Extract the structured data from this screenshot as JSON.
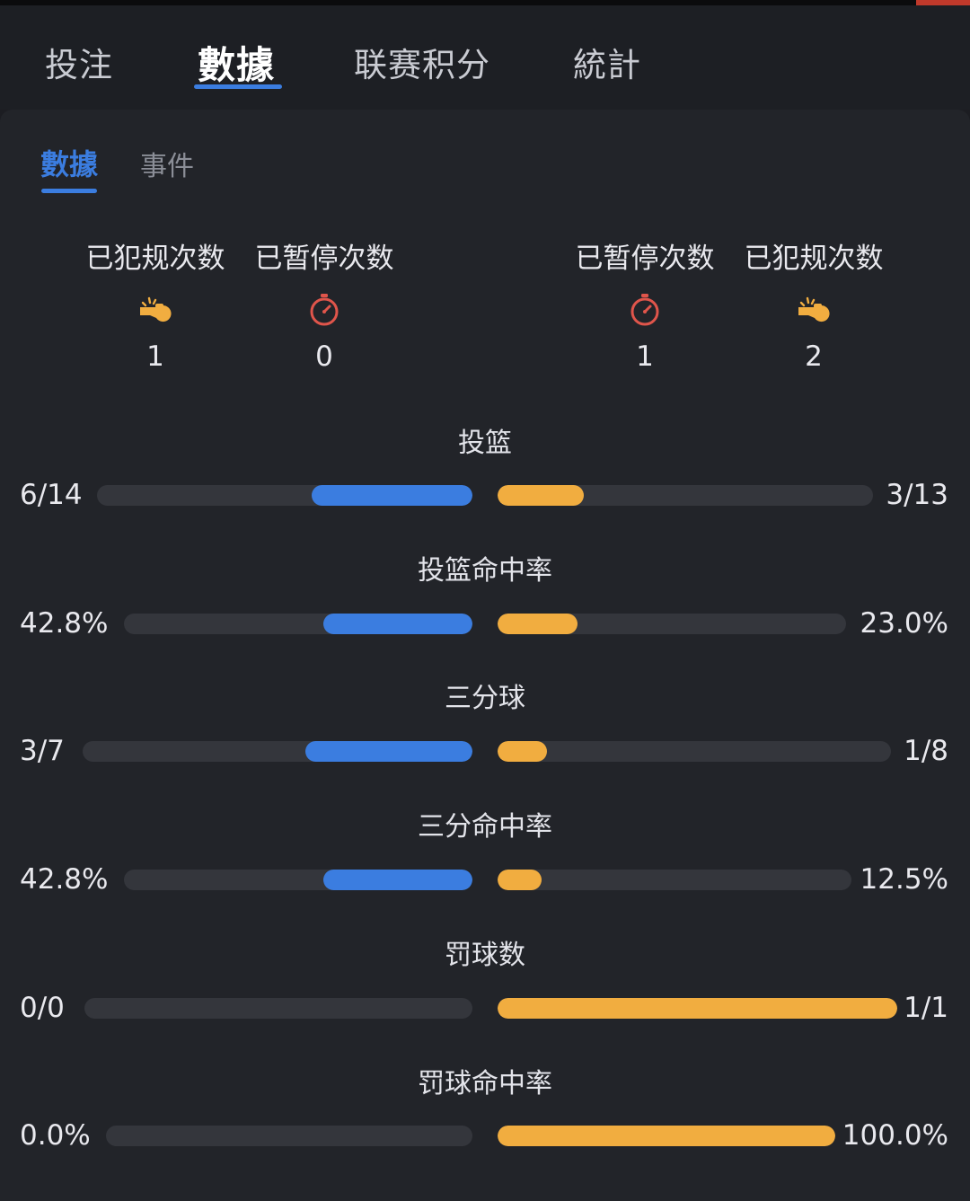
{
  "tabs": {
    "main": [
      "投注",
      "數據",
      "联赛积分",
      "統計"
    ],
    "active_main": "數據",
    "sub": [
      "數據",
      "事件"
    ],
    "active_sub": "數據"
  },
  "summary": {
    "home": {
      "fouls_label": "已犯规次数",
      "fouls_value": "1",
      "fouls_icon": "whistle-icon",
      "timeouts_label": "已暂停次数",
      "timeouts_value": "0",
      "timeouts_icon": "stopwatch-icon"
    },
    "away": {
      "timeouts_label": "已暂停次数",
      "timeouts_value": "1",
      "timeouts_icon": "stopwatch-icon",
      "fouls_label": "已犯规次数",
      "fouls_value": "2",
      "fouls_icon": "whistle-icon"
    }
  },
  "stats": [
    {
      "title": "投篮",
      "left": "6/14",
      "right": "3/13",
      "left_fraction": 0.428,
      "right_fraction": 0.23
    },
    {
      "title": "投篮命中率",
      "left": "42.8%",
      "right": "23.0%",
      "left_fraction": 0.428,
      "right_fraction": 0.23
    },
    {
      "title": "三分球",
      "left": "3/7",
      "right": "1/8",
      "left_fraction": 0.428,
      "right_fraction": 0.125
    },
    {
      "title": "三分命中率",
      "left": "42.8%",
      "right": "12.5%",
      "left_fraction": 0.428,
      "right_fraction": 0.125
    },
    {
      "title": "罚球数",
      "left": "0/0",
      "right": "1/1",
      "left_fraction": 0.0,
      "right_fraction": 1.0
    },
    {
      "title": "罚球命中率",
      "left": "0.0%",
      "right": "100.0%",
      "left_fraction": 0.0,
      "right_fraction": 1.0
    }
  ],
  "colors": {
    "home": "#3b7de0",
    "away": "#f1ad40",
    "track": "#34363c",
    "icon_whistle": "#f1ad40",
    "icon_stopwatch": "#e0554b"
  }
}
